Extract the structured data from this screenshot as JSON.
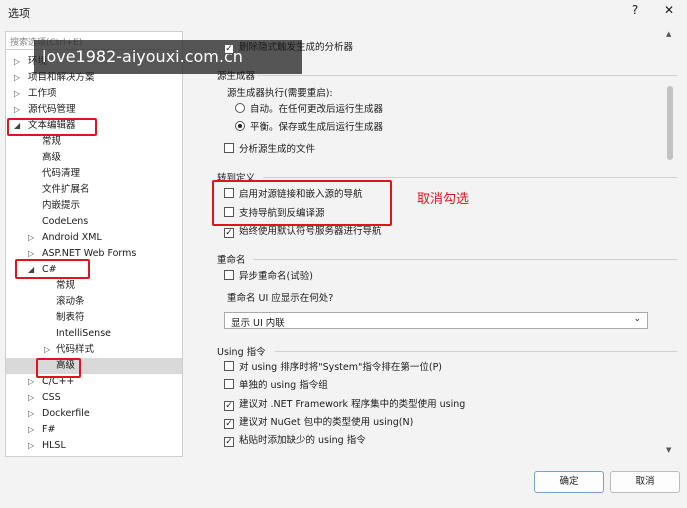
{
  "window": {
    "title": "选项",
    "help": "?",
    "close": "✕"
  },
  "search": {
    "placeholder": "搜索选项(Ctrl+E)"
  },
  "watermark": "love1982-aiyouxi.com.cn",
  "tree": [
    {
      "label": "环境",
      "level": 0,
      "arrow": "▷"
    },
    {
      "label": "项目和解决方案",
      "level": 0,
      "arrow": "▷"
    },
    {
      "label": "工作项",
      "level": 0,
      "arrow": "▷"
    },
    {
      "label": "源代码管理",
      "level": 0,
      "arrow": "▷"
    },
    {
      "label": "文本编辑器",
      "level": 0,
      "arrow": "◢"
    },
    {
      "label": "常规",
      "level": 1,
      "arrow": ""
    },
    {
      "label": "高级",
      "level": 1,
      "arrow": ""
    },
    {
      "label": "代码清理",
      "level": 1,
      "arrow": ""
    },
    {
      "label": "文件扩展名",
      "level": 1,
      "arrow": ""
    },
    {
      "label": "内嵌提示",
      "level": 1,
      "arrow": ""
    },
    {
      "label": "CodeLens",
      "level": 1,
      "arrow": ""
    },
    {
      "label": "Android XML",
      "level": 1,
      "arrow": "▷"
    },
    {
      "label": "ASP.NET Web Forms",
      "level": 1,
      "arrow": "▷"
    },
    {
      "label": "C#",
      "level": 1,
      "arrow": "◢"
    },
    {
      "label": "常规",
      "level": 2,
      "arrow": ""
    },
    {
      "label": "滚动条",
      "level": 2,
      "arrow": ""
    },
    {
      "label": "制表符",
      "level": 2,
      "arrow": ""
    },
    {
      "label": "IntelliSense",
      "level": 2,
      "arrow": ""
    },
    {
      "label": "代码样式",
      "level": 2,
      "arrow": "▷"
    },
    {
      "label": "高级",
      "level": 2,
      "arrow": "",
      "selected": true
    },
    {
      "label": "C/C++",
      "level": 1,
      "arrow": "▷"
    },
    {
      "label": "CSS",
      "level": 1,
      "arrow": "▷"
    },
    {
      "label": "Dockerfile",
      "level": 1,
      "arrow": "▷"
    },
    {
      "label": "F#",
      "level": 1,
      "arrow": "▷"
    },
    {
      "label": "HLSL",
      "level": 1,
      "arrow": "▷"
    }
  ],
  "right": {
    "top_option": "删除隐式触发生成的分析器",
    "source_gen": {
      "header": "源生成器",
      "label": "源生成器执行(需要重启):",
      "radio_auto": "自动。在任何更改后运行生成器",
      "radio_balanced": "平衡。保存或生成后运行生成器",
      "analyze": "分析源生成的文件"
    },
    "goto": {
      "header": "转到定义",
      "opt1": "启用对源链接和嵌入源的导航",
      "opt2": "支持导航到反编译源",
      "opt3": "始终使用默认符号服务器进行导航"
    },
    "rename": {
      "header": "重命名",
      "async": "异步重命名(试验)",
      "ui_label": "重命名 UI 应显示在何处?",
      "ui_value": "显示 UI 内联"
    },
    "using": {
      "header": "Using 指令",
      "opt1": "对 using 排序时将\"System\"指令排在第一位(P)",
      "opt2": "单独的 using 指令组",
      "opt3": "建议对 .NET Framework 程序集中的类型使用 using",
      "opt4": "建议对 NuGet 包中的类型使用 using(N)",
      "opt5": "粘贴时添加缺少的 using 指令"
    }
  },
  "annotation": "取消勾选",
  "buttons": {
    "ok": "确定",
    "cancel": "取消"
  },
  "colors": {
    "highlight": "#e0141e",
    "selected": "#d9d9d9"
  }
}
